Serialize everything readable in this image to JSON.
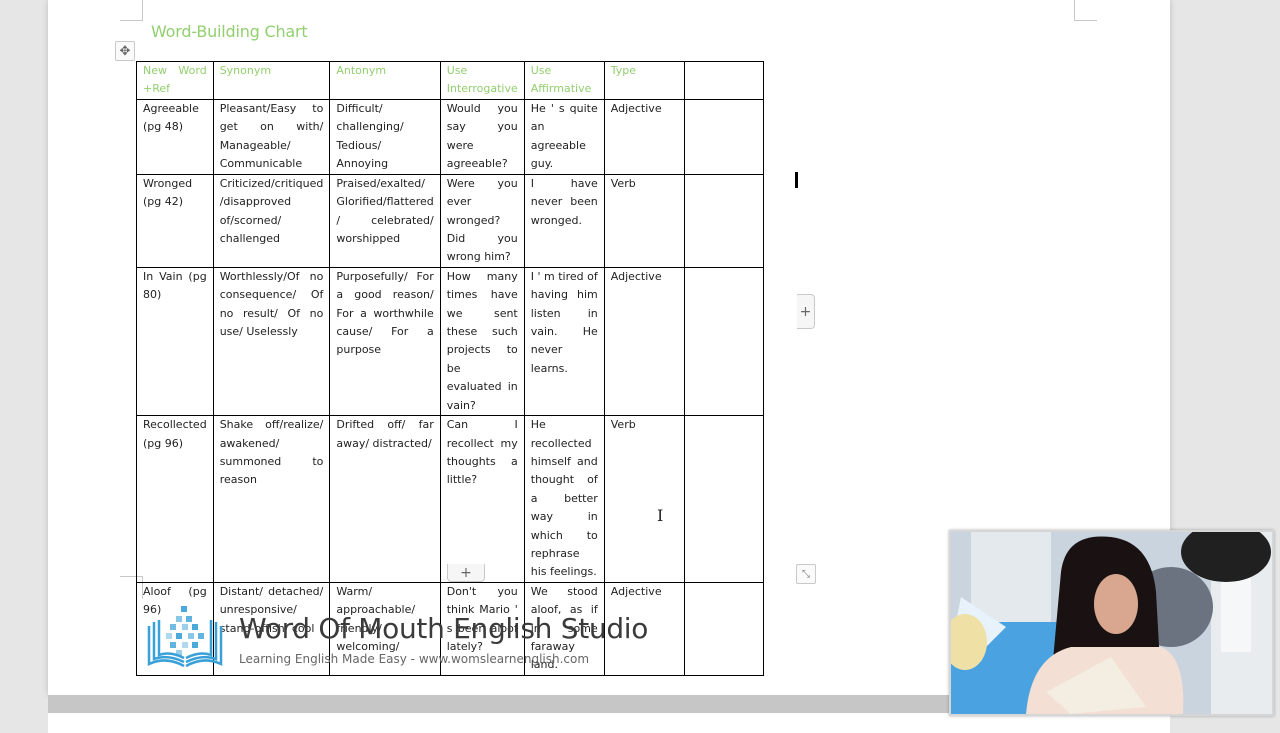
{
  "document": {
    "title": "Word-Building Chart"
  },
  "table": {
    "headers": [
      "New Word +Ref",
      "Synonym",
      "Antonym",
      "Use Interrogative",
      "Use Affirmative",
      "Type",
      ""
    ],
    "rows": [
      [
        "Agreeable (pg 48)",
        "Pleasant/Easy to get on with/ Manageable/ Communicable",
        "Difficult/ challenging/ Tedious/ Annoying",
        "Would you say you were agreeable?",
        "He ' s quite an agreeable guy.",
        "Adjective",
        ""
      ],
      [
        "Wronged (pg 42)",
        "Criticized/critiqued /disapproved of/scorned/ challenged",
        "Praised/exalted/ Glorified/flattered / celebrated/ worshipped",
        "Were you ever wronged? Did you wrong him?",
        "I have never been wronged.",
        "Verb",
        ""
      ],
      [
        "In Vain (pg 80)",
        "Worthlessly/Of no consequence/ Of no result/ Of no use/ Uselessly",
        "Purposefully/ For a good reason/ For a worthwhile cause/ For a purpose",
        "How many times have we sent these such projects to be evaluated in vain?",
        "I ' m tired of having him listen in vain. He never learns.",
        "Adjective",
        ""
      ],
      [
        "Recollected (pg 96)",
        "Shake off/realize/ awakened/ summoned to reason",
        "Drifted off/ far away/ distracted/",
        "Can I recollect my thoughts a little?",
        "He recollected himself and thought of a better way in which to rephrase his feelings.",
        "Verb",
        ""
      ],
      [
        "Aloof (pg 96)",
        "Distant/ detached/ unresponsive/ stand-offish/ cool",
        "Warm/ approachable/ friendly/ welcoming/",
        "Don't you think Mario ' s been aloof lately?",
        "We stood aloof, as if in some faraway land.",
        "Adjective",
        ""
      ]
    ]
  },
  "controls": {
    "move_icon": "✥",
    "add_row_icon": "+",
    "add_column_icon": "+",
    "resize_icon": "⤡"
  },
  "branding": {
    "name": "Word Of Mouth English Studio",
    "tagline": "Learning English Made Easy  -  www.womslearnenglish.com",
    "logo_color": "#3aa0d8"
  },
  "colors": {
    "header_text": "#92cf6f",
    "title_text": "#92cf6f"
  }
}
